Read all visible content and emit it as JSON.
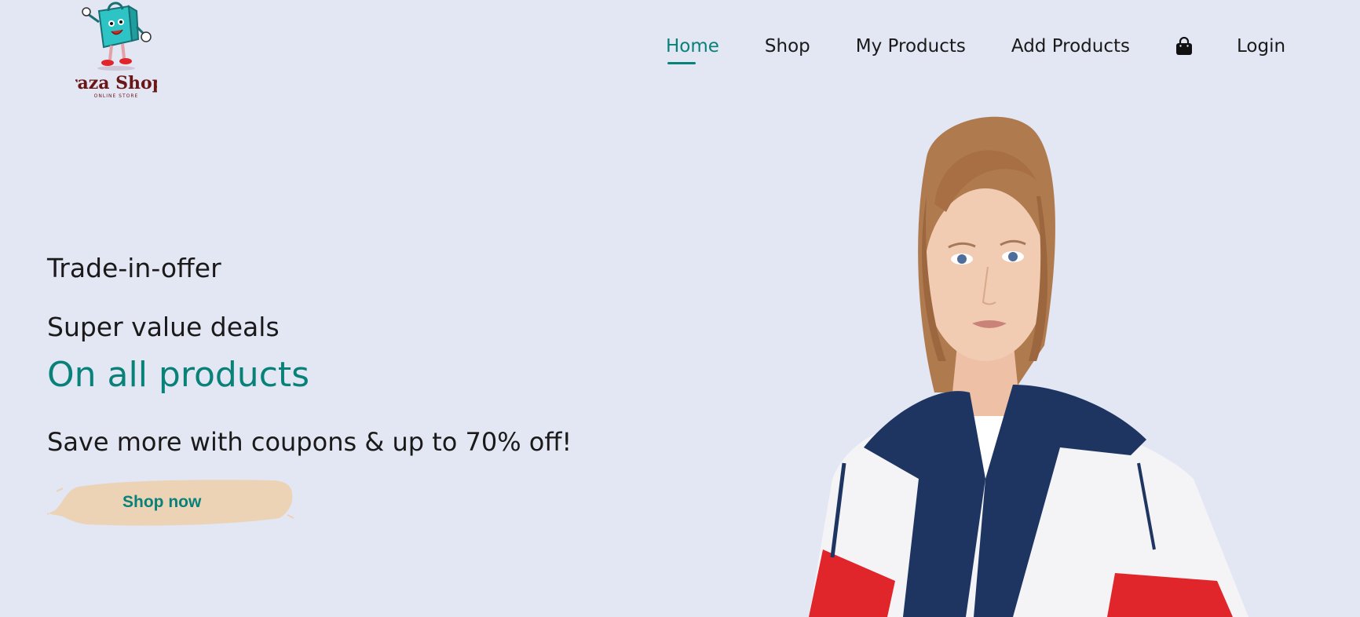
{
  "brand": {
    "name": "raza Shop",
    "tagline": "ONLINE STORE",
    "logo_icon": "shopping-bag-mascot"
  },
  "nav": {
    "items": [
      {
        "label": "Home",
        "active": true
      },
      {
        "label": "Shop",
        "active": false
      },
      {
        "label": "My Products",
        "active": false
      },
      {
        "label": "Add Products",
        "active": false
      },
      {
        "icon": "shopping-bag-icon"
      },
      {
        "label": "Login",
        "active": false
      }
    ]
  },
  "hero": {
    "eyebrow": "Trade-in-offer",
    "headline": "Super value deals",
    "highlight": "On all products",
    "subtext": "Save more with coupons & up to 70% off!",
    "cta_label": "Shop now",
    "image": "model-in-windbreaker-jacket"
  },
  "colors": {
    "background": "#e3e6f3",
    "accent": "#088178",
    "cta_brush": "#ecd3b6",
    "text": "#1a1a1a"
  }
}
